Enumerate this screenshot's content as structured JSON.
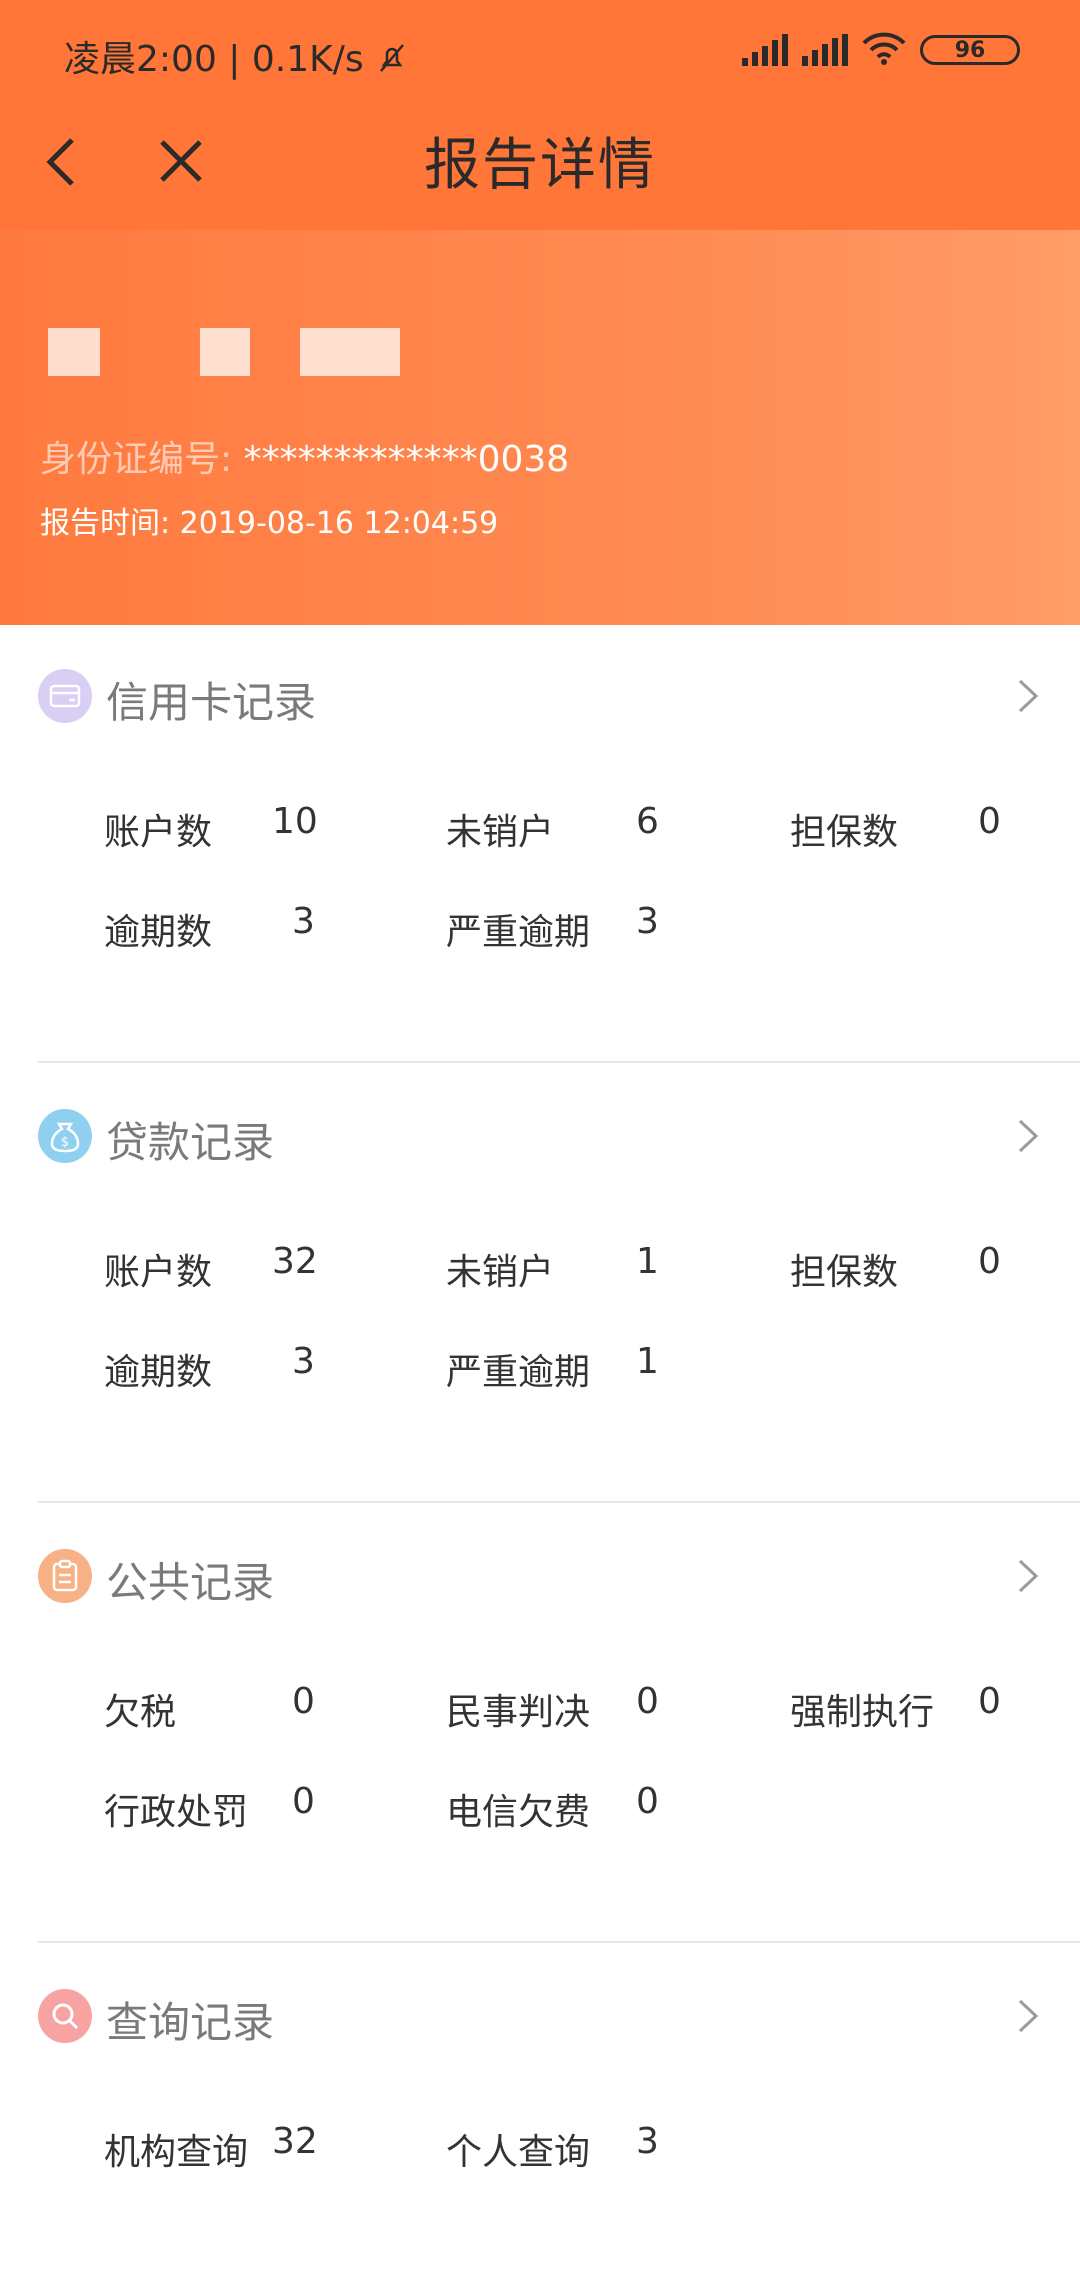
{
  "status_bar": {
    "time": "凌晨2:00",
    "speed": "0.1K/s",
    "battery": "96"
  },
  "nav": {
    "title": "报告详情"
  },
  "header": {
    "id_label": "身份证编号:",
    "id_value": "*************0038",
    "report_time": "报告时间: 2019-08-16 12:04:59"
  },
  "sections": {
    "credit_card": {
      "title": "信用卡记录",
      "color": "#c9b8f0",
      "stats": [
        {
          "label": "账户数",
          "value": "10"
        },
        {
          "label": "未销户",
          "value": "6"
        },
        {
          "label": "担保数",
          "value": "0"
        },
        {
          "label": "逾期数",
          "value": "3"
        },
        {
          "label": "严重逾期",
          "value": "3"
        }
      ]
    },
    "loan": {
      "title": "贷款记录",
      "color": "#8fd0f0",
      "stats": [
        {
          "label": "账户数",
          "value": "32"
        },
        {
          "label": "未销户",
          "value": "1"
        },
        {
          "label": "担保数",
          "value": "0"
        },
        {
          "label": "逾期数",
          "value": "3"
        },
        {
          "label": "严重逾期",
          "value": "1"
        }
      ]
    },
    "public": {
      "title": "公共记录",
      "color": "#f7b184",
      "stats": [
        {
          "label": "欠税",
          "value": "0"
        },
        {
          "label": "民事判决",
          "value": "0"
        },
        {
          "label": "强制执行",
          "value": "0"
        },
        {
          "label": "行政处罚",
          "value": "0"
        },
        {
          "label": "电信欠费",
          "value": "0"
        }
      ]
    },
    "query": {
      "title": "查询记录",
      "color": "#f7a3a3",
      "stats": [
        {
          "label": "机构查询",
          "value": "32"
        },
        {
          "label": "个人查询",
          "value": "3"
        }
      ]
    }
  }
}
